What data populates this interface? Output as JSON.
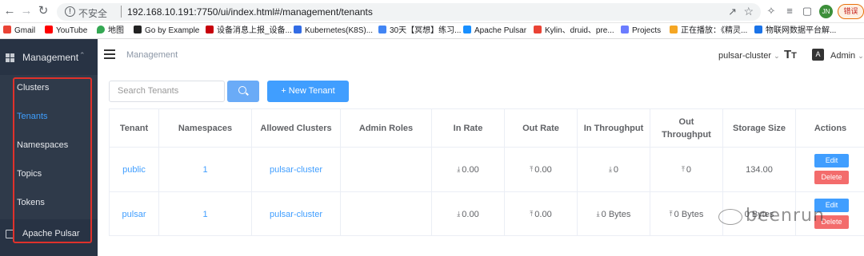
{
  "browser": {
    "insecure_label": "不安全",
    "url": "192.168.10.191:7750/ui/index.html#/management/tenants",
    "profile_initials": "JN",
    "error_pill": "错误"
  },
  "bookmarks": [
    {
      "label": "Gmail",
      "color": "#ea4335"
    },
    {
      "label": "YouTube",
      "color": "#ff0000"
    },
    {
      "label": "地图",
      "color": "#34a853"
    },
    {
      "label": "Go by Example",
      "color": "#222222"
    },
    {
      "label": "设备消息上报_设备...",
      "color": "#c7000b"
    },
    {
      "label": "Kubernetes(K8S)...",
      "color": "#326ce5"
    },
    {
      "label": "30天【冥想】练习...",
      "color": "#4285f4"
    },
    {
      "label": "Apache Pulsar",
      "color": "#188fff"
    },
    {
      "label": "Kylin、druid、pre...",
      "color": "#ea4335"
    },
    {
      "label": "Projects",
      "color": "#6b7cff"
    },
    {
      "label": "正在播放：《精灵...",
      "color": "#f5a623"
    },
    {
      "label": "物联网数据平台解...",
      "color": "#1a73e8"
    }
  ],
  "sidebar": {
    "section_title": "Management",
    "items": [
      "Clusters",
      "Tenants",
      "Namespaces",
      "Topics",
      "Tokens"
    ],
    "active_index": 1,
    "external_link": "Apache Pulsar"
  },
  "header": {
    "breadcrumb": "Management",
    "cluster_select": "pulsar-cluster",
    "font_icon_text": "T",
    "lang_icon_text": "A",
    "user_menu": "Admin"
  },
  "toolbar": {
    "search_placeholder": "Search Tenants",
    "new_button": "+ New Tenant"
  },
  "table": {
    "headers": [
      "Tenant",
      "Namespaces",
      "Allowed Clusters",
      "Admin Roles",
      "In Rate",
      "Out Rate",
      "In Throughput",
      "Out Throughput",
      "Storage Size",
      "Actions"
    ],
    "rows": [
      {
        "tenant": "public",
        "namespaces": "1",
        "allowed_clusters": "pulsar-cluster",
        "admin_roles": "",
        "in_rate": "0.00",
        "out_rate": "0.00",
        "in_throughput": "0",
        "out_throughput": "0",
        "storage_size": "134.00"
      },
      {
        "tenant": "pulsar",
        "namespaces": "1",
        "allowed_clusters": "pulsar-cluster",
        "admin_roles": "",
        "in_rate": "0.00",
        "out_rate": "0.00",
        "in_throughput": "0 Bytes",
        "out_throughput": "0 Bytes",
        "storage_size": "0 Bytes"
      }
    ],
    "edit_label": "Edit",
    "delete_label": "Delete"
  },
  "watermark": "beenrun",
  "colors": {
    "sidebar_bg": "#2f3a4a",
    "accent": "#409eff",
    "danger": "#f36c6c",
    "highlight_box": "#e0312b"
  }
}
